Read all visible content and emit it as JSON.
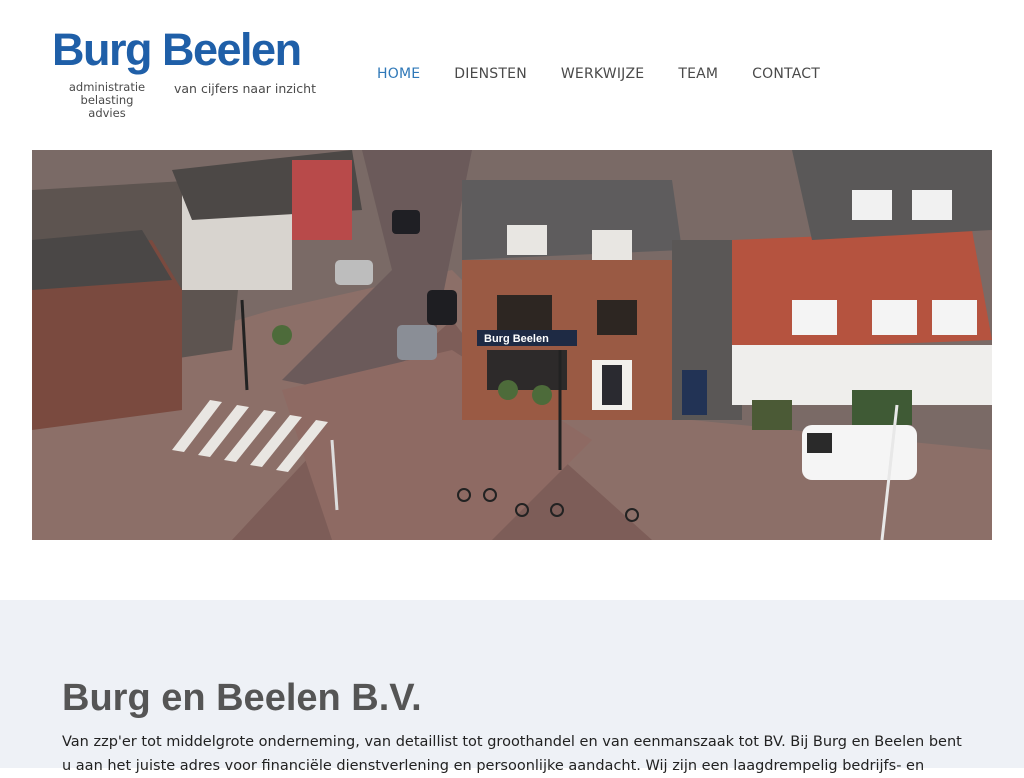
{
  "brand": {
    "name": "Burg Beelen",
    "sub_lines": [
      "administratie",
      "belasting",
      "advies"
    ],
    "tagline": "van cijfers naar inzicht"
  },
  "nav": {
    "items": [
      {
        "label": "HOME",
        "active": true
      },
      {
        "label": "DIENSTEN",
        "active": false
      },
      {
        "label": "WERKWIJZE",
        "active": false
      },
      {
        "label": "TEAM",
        "active": false
      },
      {
        "label": "CONTACT",
        "active": false
      }
    ]
  },
  "hero": {
    "shop_sign": "Burg Beelen"
  },
  "intro": {
    "title": "Burg en Beelen B.V.",
    "text": "Van zzp'er tot middelgrote onderneming, van detaillist tot groothandel en van eenmanszaak tot BV. Bij Burg en Beelen bent u aan het juiste adres voor financiële dienstverlening en persoonlijke aandacht. Wij zijn een laagdrempelig bedrijfs- en"
  },
  "colors": {
    "brand_blue": "#1f5fa8",
    "nav_active": "#2f78b8",
    "intro_bg": "#eef1f6"
  }
}
